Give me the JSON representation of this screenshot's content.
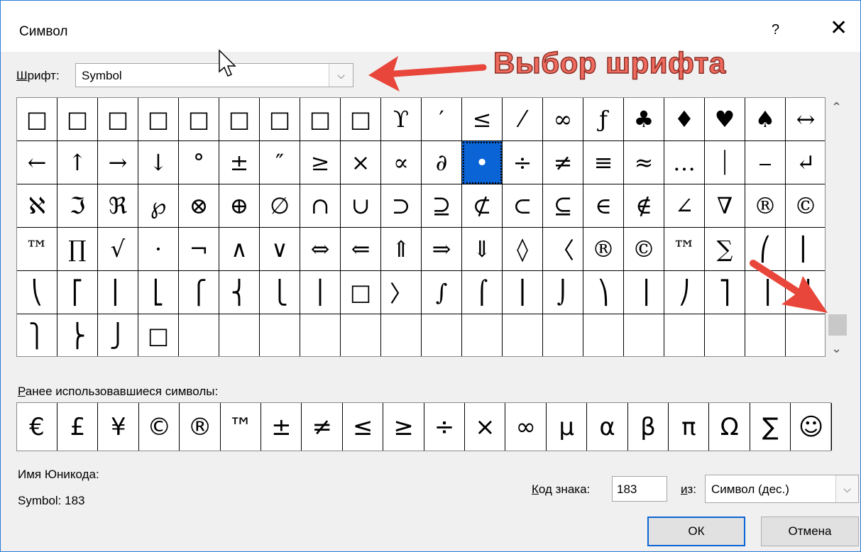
{
  "dialog": {
    "title": "Символ",
    "help_label": "?",
    "close_label": "✕"
  },
  "font": {
    "label_prefix": "Ш",
    "label_rest": "рифт:",
    "value": "Symbol",
    "dropdown_arrow": "⌵"
  },
  "annotation": {
    "text": "Выбор шрифта",
    "color": "#ef6b5e"
  },
  "symbol_grid": {
    "rows": [
      [
        "□",
        "□",
        "□",
        "□",
        "□",
        "□",
        "□",
        "□",
        "□",
        "ϒ",
        "′",
        "≤",
        "⁄",
        "∞",
        "ƒ",
        "♣",
        "♦",
        "♥",
        "♠",
        "↔"
      ],
      [
        "←",
        "↑",
        "→",
        "↓",
        "°",
        "±",
        "″",
        "≥",
        "×",
        "∝",
        "∂",
        "•",
        "÷",
        "≠",
        "≡",
        "≈",
        "…",
        "⏐",
        "⎯",
        "↵"
      ],
      [
        "ℵ",
        "ℑ",
        "ℜ",
        "℘",
        "⊗",
        "⊕",
        "∅",
        "∩",
        "∪",
        "⊃",
        "⊇",
        "⊄",
        "⊂",
        "⊆",
        "∈",
        "∉",
        "∠",
        "∇",
        "®",
        "©"
      ],
      [
        "™",
        "∏",
        "√",
        "⋅",
        "¬",
        "∧",
        "∨",
        "⇔",
        "⇐",
        "⇑",
        "⇒",
        "⇓",
        "◊",
        "〈",
        "®",
        "©",
        "™",
        "∑",
        "⎛",
        "⎜"
      ],
      [
        "⎝",
        "⎡",
        "⎢",
        "⎣",
        "⎧",
        "⎨",
        "⎩",
        "⎪",
        "□",
        "〉",
        "∫",
        "⌠",
        "⎮",
        "⌡",
        "⎞",
        "⎟",
        "⎠",
        "⎤",
        "⎥",
        "⎦"
      ],
      [
        "⎫",
        "⎬",
        "⎭",
        "□",
        "",
        "",
        "",
        "",
        "",
        "",
        "",
        "",
        "",
        "",
        "",
        "",
        "",
        "",
        "",
        ""
      ]
    ],
    "selected_index": [
      1,
      11
    ],
    "selected_color": "#0a64d6"
  },
  "scroll": {
    "up_arrow": "⌃",
    "down_arrow": "⌄"
  },
  "recent": {
    "label_prefix": "Р",
    "label_rest": "анее использовавшиеся символы:",
    "symbols": [
      "€",
      "£",
      "¥",
      "©",
      "®",
      "™",
      "±",
      "≠",
      "≤",
      "≥",
      "÷",
      "×",
      "∞",
      "µ",
      "α",
      "β",
      "π",
      "Ω",
      "∑",
      "☺"
    ]
  },
  "unicode_name": {
    "label": "Имя Юникода:",
    "value": "Symbol: 183"
  },
  "code": {
    "label_prefix": "К",
    "label_rest": "од знака:",
    "value": "183",
    "from_label_prefix": "и",
    "from_label_rest": "з:",
    "from_value": "Символ (дес.)",
    "from_arrow": "⌵"
  },
  "buttons": {
    "ok": "ОК",
    "cancel": "Отмена"
  }
}
